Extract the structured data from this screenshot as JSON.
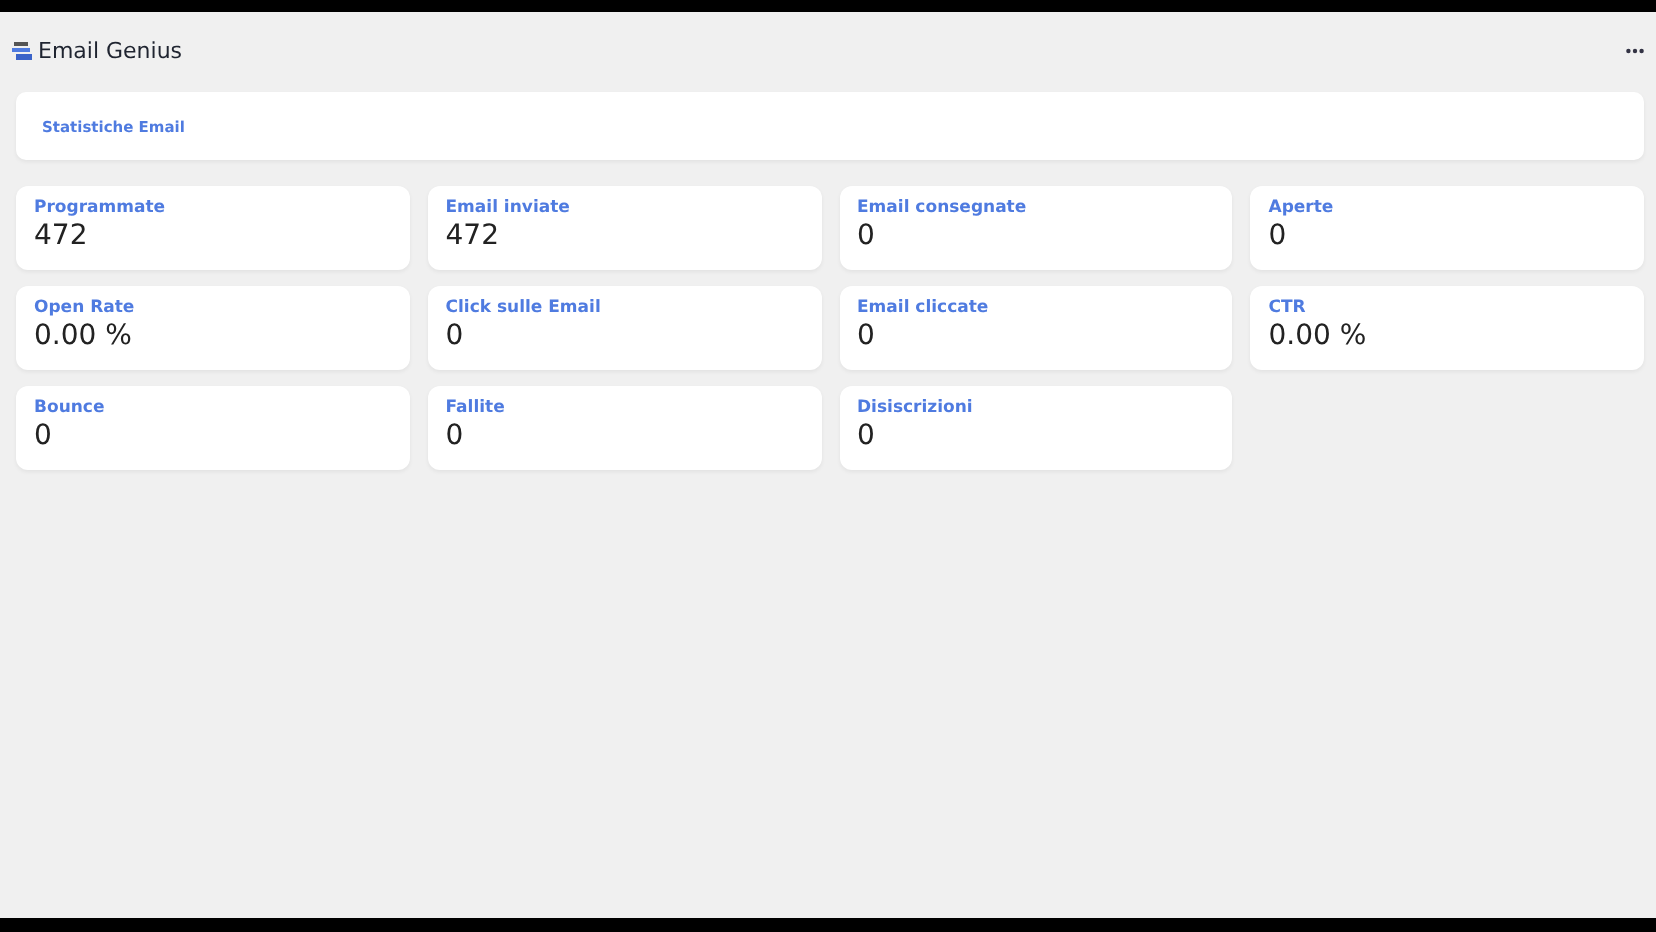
{
  "app": {
    "title": "Email Genius"
  },
  "section": {
    "title": "Statistiche Email"
  },
  "stats": [
    {
      "label": "Programmate",
      "value": "472"
    },
    {
      "label": "Email inviate",
      "value": "472"
    },
    {
      "label": "Email consegnate",
      "value": "0"
    },
    {
      "label": "Aperte",
      "value": "0"
    },
    {
      "label": "Open Rate",
      "value": "0.00 %"
    },
    {
      "label": "Click sulle Email",
      "value": "0"
    },
    {
      "label": "Email cliccate",
      "value": "0"
    },
    {
      "label": "CTR",
      "value": "0.00 %"
    },
    {
      "label": "Bounce",
      "value": "0"
    },
    {
      "label": "Fallite",
      "value": "0"
    },
    {
      "label": "Disiscrizioni",
      "value": "0"
    }
  ]
}
